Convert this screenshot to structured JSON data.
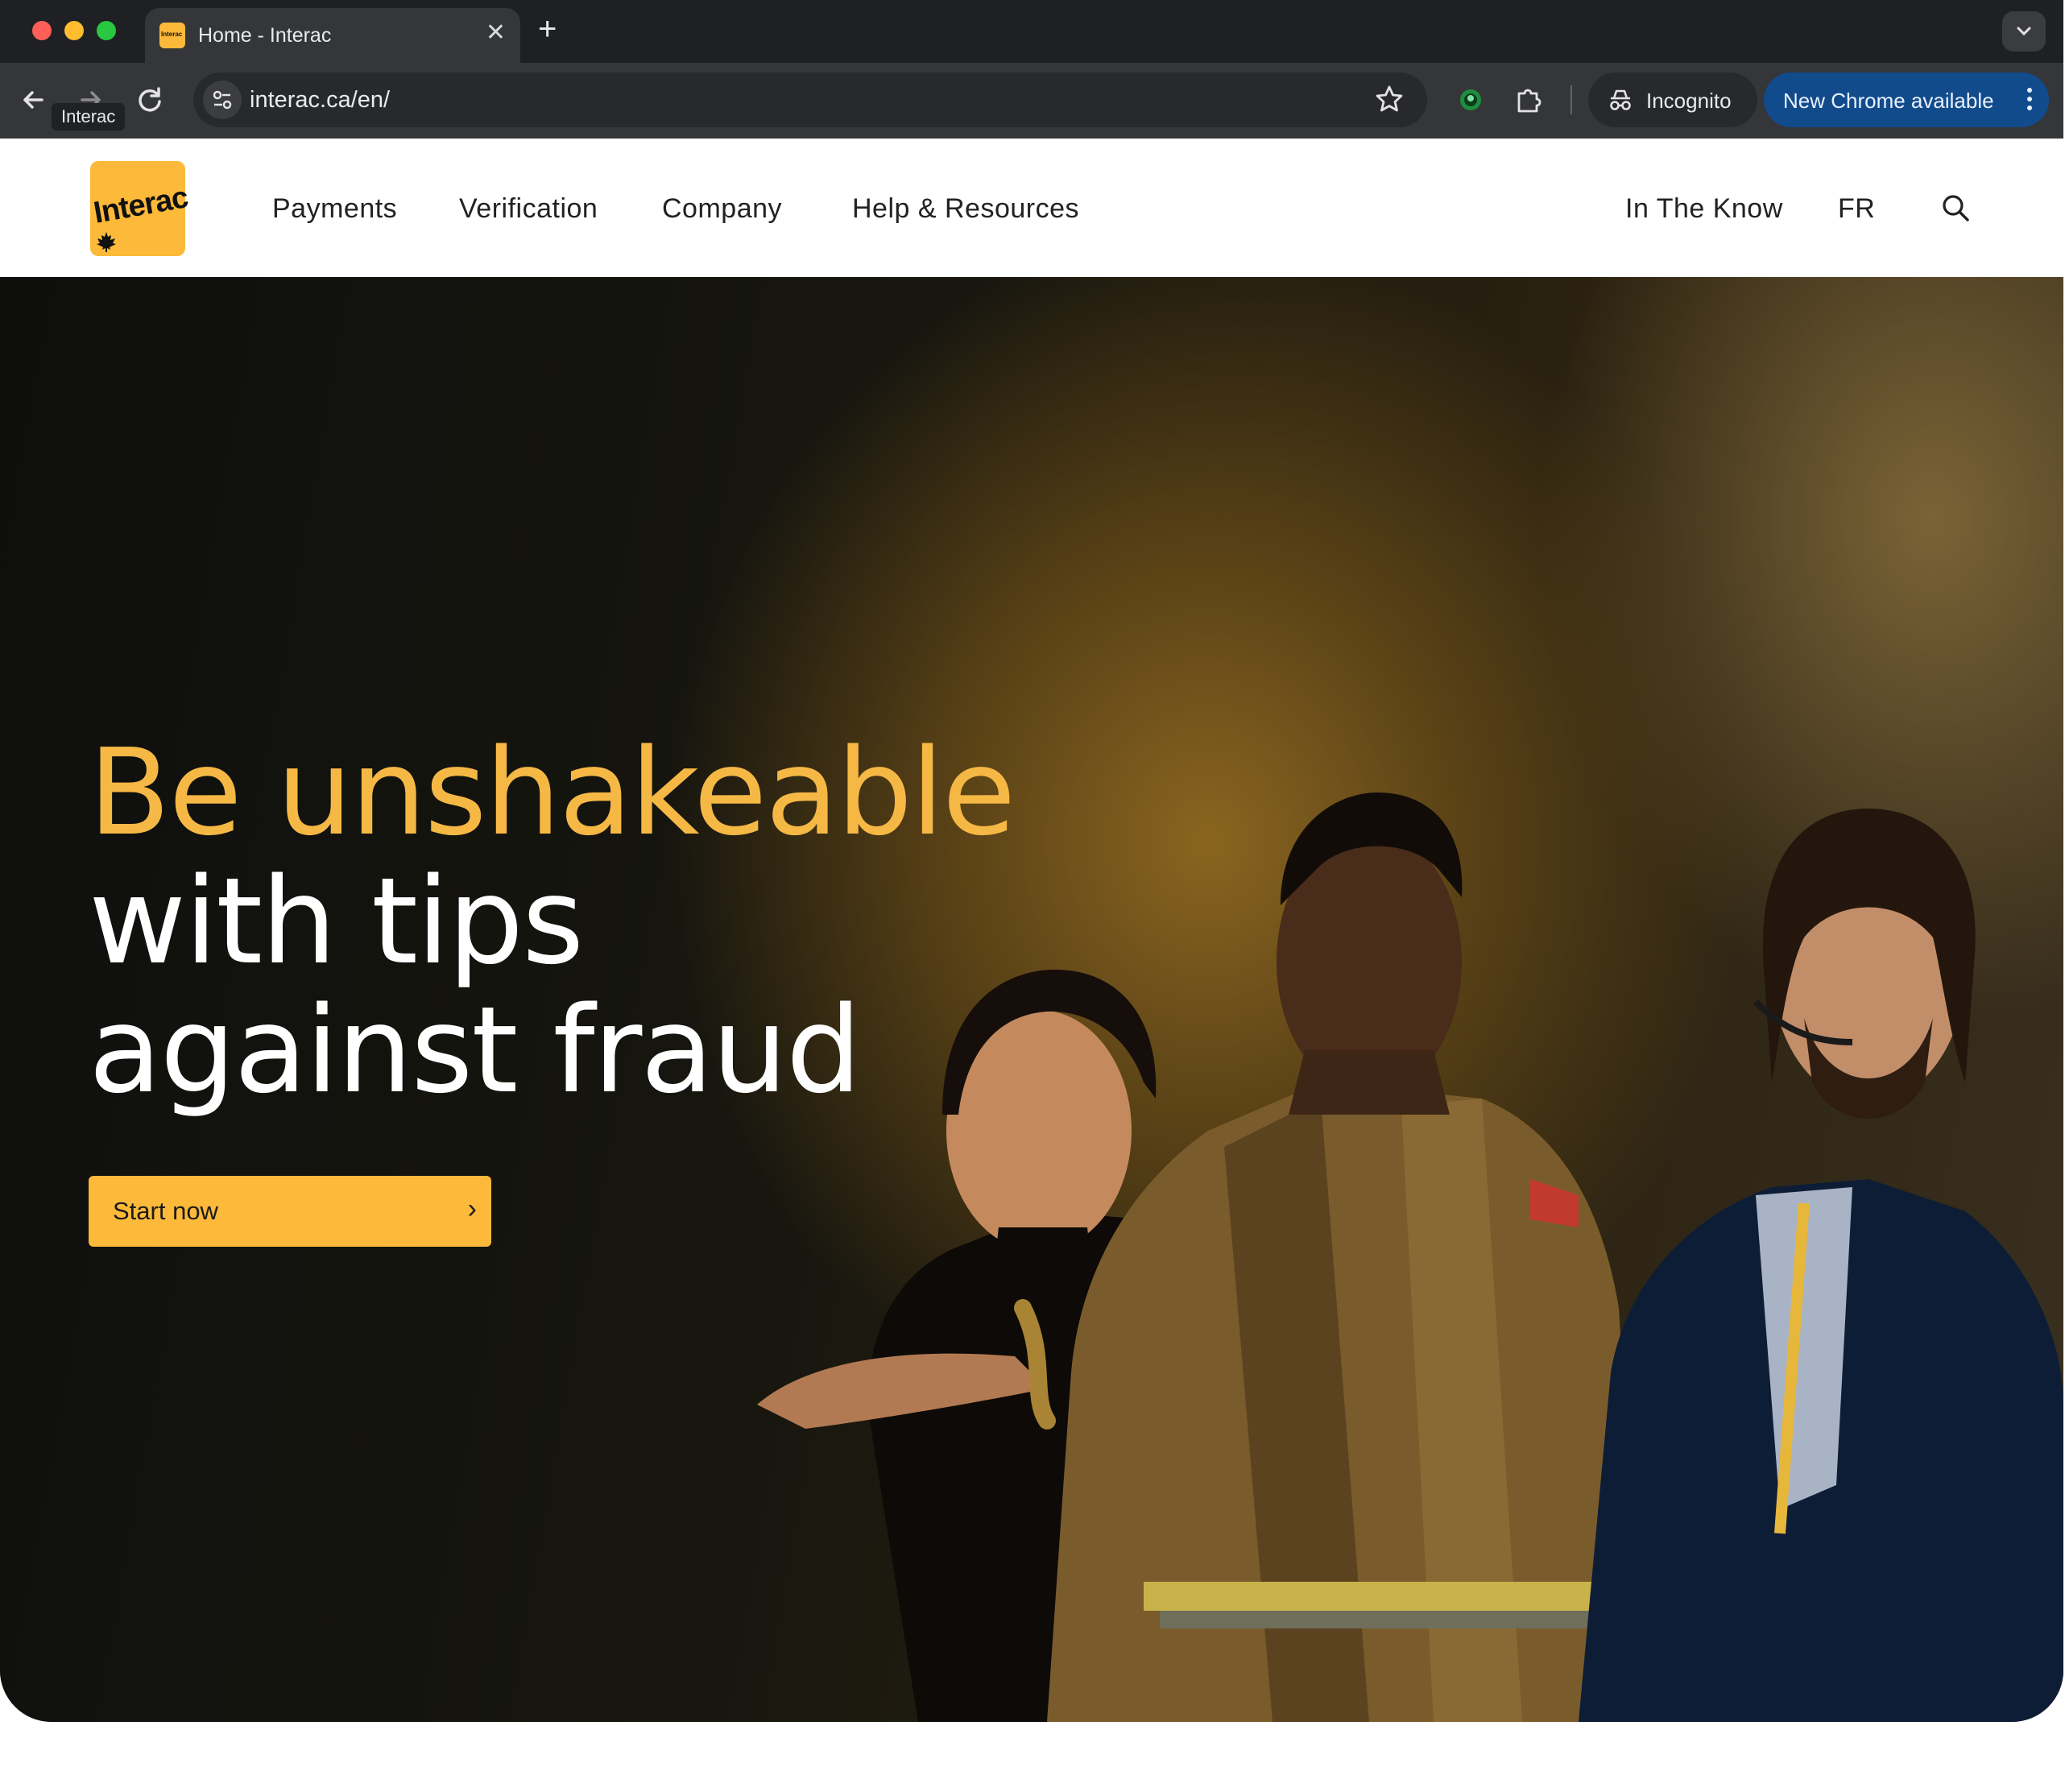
{
  "browser": {
    "tab_title": "Home - Interac",
    "tab_favicon_text": "Interac",
    "close_glyph": "✕",
    "newtab_glyph": "+",
    "url": "interac.ca/en/",
    "tooltip": "Interac",
    "incognito_label": "Incognito",
    "update_label": "New Chrome available",
    "icons": [
      "back-icon",
      "forward-icon",
      "reload-icon",
      "site-info-icon",
      "star-icon",
      "extension-icon",
      "puzzle-icon",
      "incognito-icon",
      "kebab-icon"
    ]
  },
  "site": {
    "logo_text": "Interac",
    "nav": {
      "payments": "Payments",
      "verification": "Verification",
      "company": "Company",
      "help": "Help & Resources",
      "in_the_know": "In The Know",
      "lang": "FR"
    }
  },
  "hero": {
    "headline_accent": "Be unshakeable",
    "headline_line2": "with tips",
    "headline_line3": "against fraud",
    "cta_label": "Start now",
    "cta_chevron": "›"
  },
  "colors": {
    "brand_yellow": "#fdb93a",
    "accent_text": "#f6b845",
    "chrome_update_blue": "#124b8c"
  }
}
